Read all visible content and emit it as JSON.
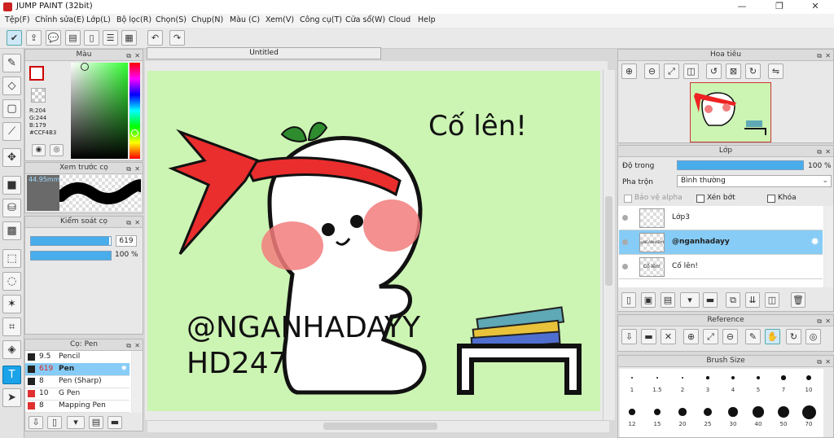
{
  "app": {
    "title": "JUMP PAINT (32bit)",
    "window_controls": [
      "—",
      "❐",
      "✕"
    ]
  },
  "menu": [
    "Tệp(F)",
    "Chỉnh sửa(E)",
    "Lớp(L)",
    "Bộ lọc(R)",
    "Chọn(S)",
    "Chụp(N)",
    "Màu (C)",
    "Xem(V)",
    "Công cụ(T)",
    "Cửa sổ(W)",
    "Cloud",
    "Help"
  ],
  "toolbar": {
    "icons": [
      "check-icon",
      "export-icon",
      "chat-icon",
      "comment-icon",
      "page-icon",
      "layers-icon",
      "grid-icon",
      "undo-icon",
      "redo-icon"
    ]
  },
  "document": {
    "tab_title": "Untitled"
  },
  "color_panel": {
    "title": "Màu",
    "r": "R:204",
    "g": "G:244",
    "b": "B:179",
    "hex": "#CCF4B3",
    "current_color": "#ccf4b3"
  },
  "brush_preview": {
    "title": "Xem trước cọ",
    "size": "44.95mm"
  },
  "brush_control": {
    "title": "Kiểm soát cọ",
    "size_value": "619",
    "opacity_value": "100 %",
    "size_fraction": 0.98,
    "opacity_fraction": 1.0
  },
  "pen_panel": {
    "title": "Cọ: Pen",
    "items": [
      {
        "size": "9.5",
        "name": "Pencil",
        "color": "#222222"
      },
      {
        "size": "619",
        "name": "Pen",
        "color": "#222222",
        "selected": true
      },
      {
        "size": "8",
        "name": "Pen (Sharp)",
        "color": "#222222"
      },
      {
        "size": "10",
        "name": "G Pen",
        "color": "#e03030"
      },
      {
        "size": "8",
        "name": "Mapping Pen",
        "color": "#e03030"
      }
    ]
  },
  "artwork": {
    "caption": "Cố lên!",
    "watermark_line1": "@NGANHADAYY",
    "watermark_line2": "HD247",
    "background": "#ccf4b3"
  },
  "navigator": {
    "title": "Hoa tiêu"
  },
  "layer_panel": {
    "title": "Lớp",
    "opacity_label": "Độ trong",
    "opacity_value": "100 %",
    "opacity_fraction": 1.0,
    "blend_label": "Pha trộn",
    "blend_value": "Bình thường",
    "protect_alpha": "Bảo vệ alpha",
    "clipping": "Xén bớt",
    "lock": "Khóa",
    "layers": [
      {
        "name": "Lớp3",
        "selected": false,
        "thumb_text": ""
      },
      {
        "name": "@nganhadayy",
        "selected": true,
        "thumb_text": "@NGANHADAYY"
      },
      {
        "name": "Cố lên!",
        "selected": false,
        "thumb_text": "Cố lên!"
      }
    ]
  },
  "reference": {
    "title": "Reference"
  },
  "brush_size": {
    "title": "Brush Size",
    "row1": [
      "1",
      "1.5",
      "2",
      "3",
      "4",
      "5",
      "7",
      "10"
    ],
    "row2": [
      "12",
      "15",
      "20",
      "25",
      "30",
      "40",
      "50",
      "70"
    ]
  }
}
